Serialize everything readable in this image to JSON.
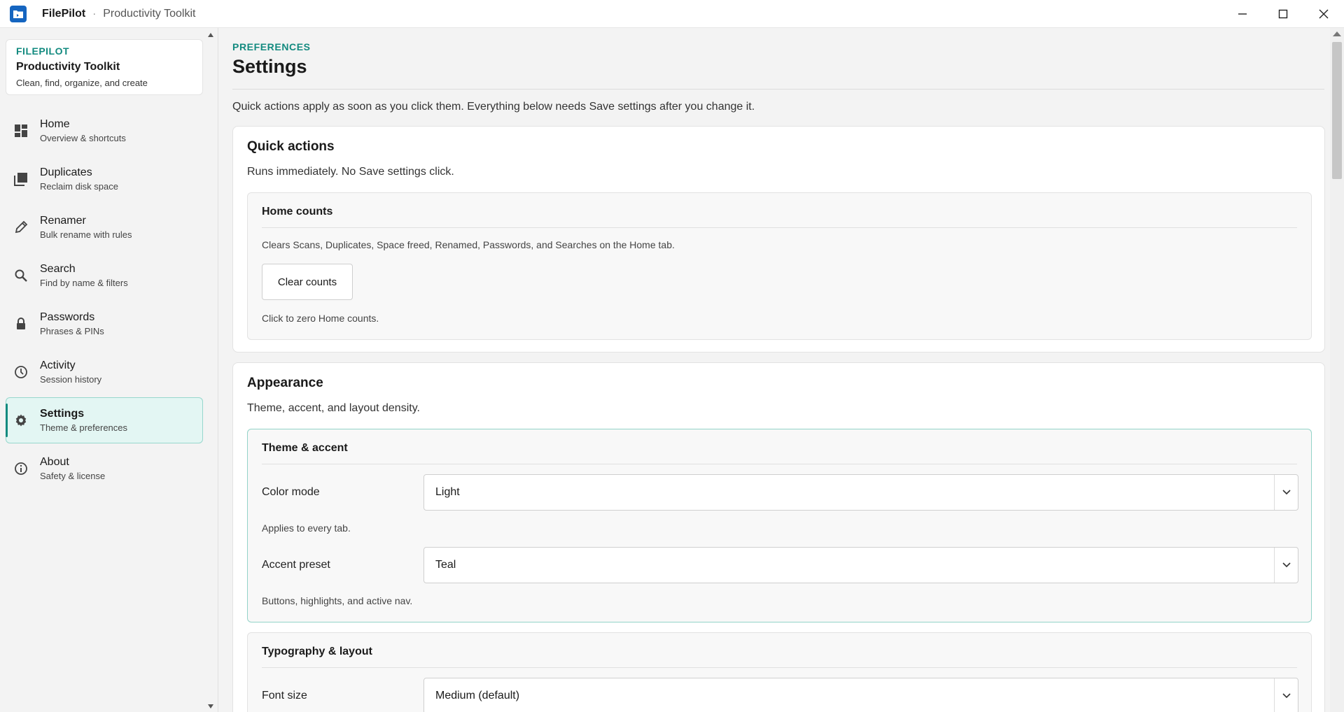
{
  "titlebar": {
    "app_name": "FilePilot",
    "separator": "·",
    "subtitle": "Productivity Toolkit"
  },
  "sidebar": {
    "brand": {
      "kicker": "FILEPILOT",
      "title": "Productivity Toolkit",
      "description": "Clean, find, organize, and create"
    },
    "items": [
      {
        "label": "Home",
        "sub": "Overview & shortcuts",
        "icon": "dashboard-icon"
      },
      {
        "label": "Duplicates",
        "sub": "Reclaim disk space",
        "icon": "copy-stack-icon"
      },
      {
        "label": "Renamer",
        "sub": "Bulk rename with rules",
        "icon": "pencil-icon"
      },
      {
        "label": "Search",
        "sub": "Find by name & filters",
        "icon": "search-icon"
      },
      {
        "label": "Passwords",
        "sub": "Phrases & PINs",
        "icon": "lock-icon"
      },
      {
        "label": "Activity",
        "sub": "Session history",
        "icon": "clock-icon"
      },
      {
        "label": "Settings",
        "sub": "Theme & preferences",
        "icon": "gear-icon",
        "active": true
      },
      {
        "label": "About",
        "sub": "Safety & license",
        "icon": "info-icon"
      }
    ]
  },
  "main": {
    "kicker": "PREFERENCES",
    "title": "Settings",
    "intro": "Quick actions apply as soon as you click them. Everything below needs Save settings after you change it.",
    "quick_actions": {
      "title": "Quick actions",
      "description": "Runs immediately. No Save settings click.",
      "home_counts": {
        "title": "Home counts",
        "description": "Clears Scans, Duplicates, Space freed, Renamed, Passwords, and Searches on the Home tab.",
        "button": "Clear counts",
        "hint": "Click to zero Home counts."
      }
    },
    "appearance": {
      "title": "Appearance",
      "description": "Theme, accent, and layout density.",
      "theme": {
        "title": "Theme & accent",
        "color_mode_label": "Color mode",
        "color_mode_value": "Light",
        "color_mode_hint": "Applies to every tab.",
        "accent_label": "Accent preset",
        "accent_value": "Teal",
        "accent_hint": "Buttons, highlights, and active nav."
      },
      "typography": {
        "title": "Typography & layout",
        "font_size_label": "Font size",
        "font_size_value": "Medium (default)"
      }
    }
  },
  "colors": {
    "accent": "#128a7f",
    "active_nav_bg": "#e3f6f3",
    "app_icon": "#1565c0"
  }
}
